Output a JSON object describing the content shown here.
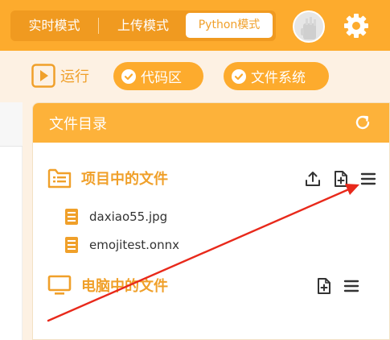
{
  "modes": {
    "realtime_label": "实时模式",
    "upload_label": "上传模式",
    "python_label": "Python模式"
  },
  "toolbar": {
    "run_label": "运行",
    "code_label": "代码区",
    "fs_label": "文件系统"
  },
  "file_panel": {
    "title": "文件目录",
    "project_section_label": "项目中的文件",
    "project_files": [
      {
        "name": "daxiao55.jpg"
      },
      {
        "name": "emojitest.onnx"
      }
    ],
    "computer_section_label": "电脑中的文件"
  },
  "colors": {
    "accent": "#fdab2d",
    "accent_dark": "#f0a02a",
    "background": "#fdf1e3",
    "annotation_arrow": "#e8291b"
  },
  "icons": [
    "avatar",
    "gear-icon",
    "play-icon",
    "check-circle-icon",
    "refresh-icon",
    "folder-list-icon",
    "file-text-icon",
    "upload-icon",
    "new-file-icon",
    "menu-icon",
    "monitor-icon"
  ]
}
